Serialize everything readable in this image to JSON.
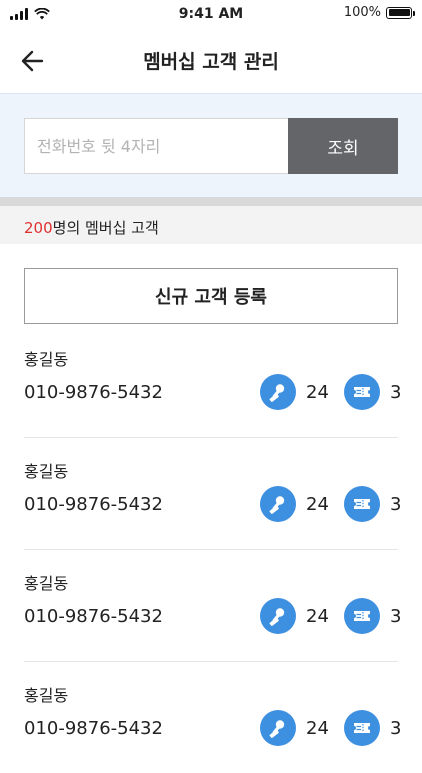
{
  "status_bar": {
    "time": "9:41 AM",
    "battery": "100%"
  },
  "header": {
    "title": "멤버십 고객 관리"
  },
  "search": {
    "placeholder": "전화번호 뒷 4자리",
    "button_label": "조회"
  },
  "summary": {
    "count": "200",
    "suffix": "명의 멤버십 고객"
  },
  "register_button": {
    "label": "신규 고객 등록"
  },
  "customers": [
    {
      "name": "홍길동",
      "phone": "010-9876-5432",
      "stamps": "24",
      "coupons": "3"
    },
    {
      "name": "홍길동",
      "phone": "010-9876-5432",
      "stamps": "24",
      "coupons": "3"
    },
    {
      "name": "홍길동",
      "phone": "010-9876-5432",
      "stamps": "24",
      "coupons": "3"
    },
    {
      "name": "홍길동",
      "phone": "010-9876-5432",
      "stamps": "24",
      "coupons": "3"
    }
  ],
  "icons": {
    "back": "back-arrow-icon",
    "stamp": "stamp-icon",
    "coupon": "coupon-icon"
  },
  "colors": {
    "accent": "#3d8fe0",
    "count_highlight": "#e03030",
    "search_button": "#636569",
    "search_area_bg": "#eef4fc"
  }
}
